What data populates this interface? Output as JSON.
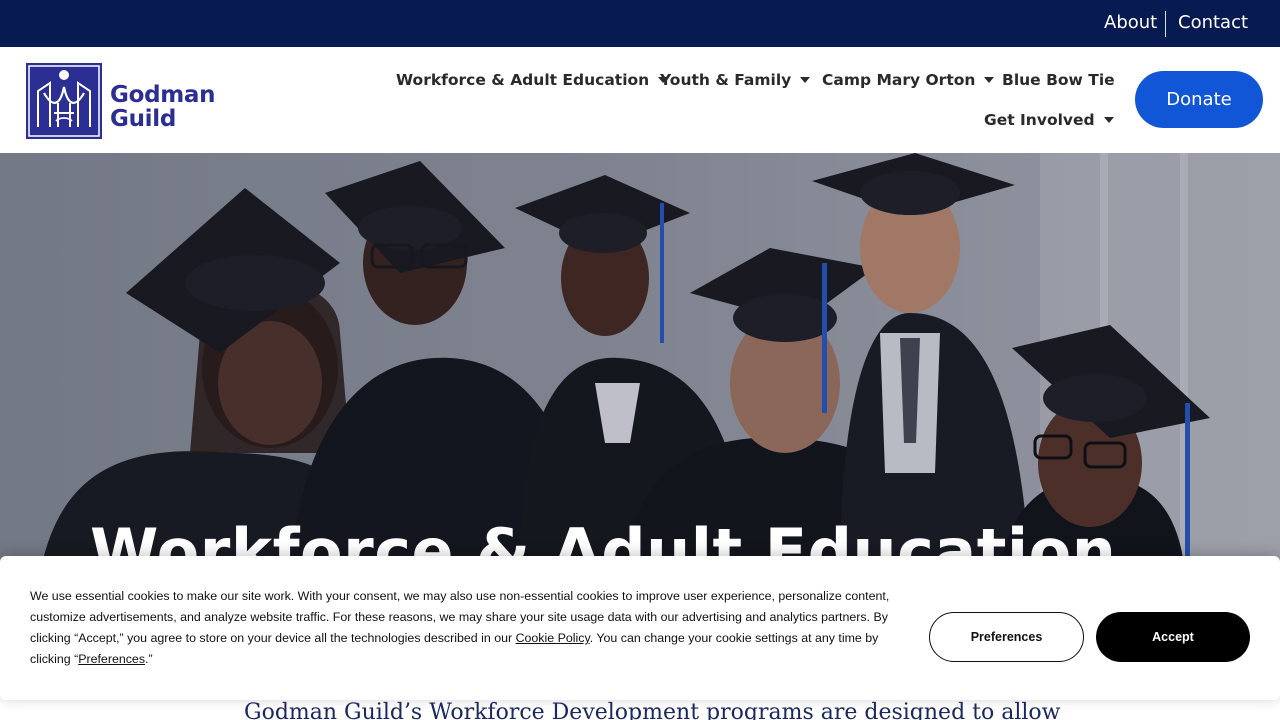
{
  "topbar": {
    "about_label": "About",
    "contact_label": "Contact"
  },
  "logo": {
    "line1": "Godman",
    "line2": "Guild"
  },
  "nav": {
    "items": [
      {
        "label": "Workforce & Adult Education",
        "has_dropdown": true
      },
      {
        "label": "Youth & Family",
        "has_dropdown": true
      },
      {
        "label": "Camp Mary Orton",
        "has_dropdown": true
      },
      {
        "label": "Blue Bow Tie",
        "has_dropdown": false
      },
      {
        "label": "Get Involved",
        "has_dropdown": true
      }
    ],
    "donate_label": "Donate"
  },
  "hero": {
    "title": "Workforce & Adult Education"
  },
  "intro": {
    "text": "Godman Guild’s Workforce Development programs are designed to allow"
  },
  "cookie": {
    "text_before_link": "We use essential cookies to make our site work. With your consent, we may also use non-essential cookies to improve user experience, personalize content, customize advertisements, and analyze website traffic. For these reasons, we may share your site usage data with our advertising and analytics partners. By clicking “Accept,” you agree to store on your device all the technologies described in our ",
    "policy_link": "Cookie Policy",
    "text_after_link": ". You can change your cookie settings at any time by clicking “",
    "preferences_link": "Preferences",
    "text_end": ".”",
    "preferences_button": "Preferences",
    "accept_button": "Accept"
  },
  "colors": {
    "topbar_bg": "#071a52",
    "brand": "#2b2e93",
    "donate_bg": "#1156d6",
    "accept_bg": "#000000"
  },
  "icons": {
    "dropdown": "caret-down-icon",
    "logo": "godman-guild-logo-icon"
  }
}
